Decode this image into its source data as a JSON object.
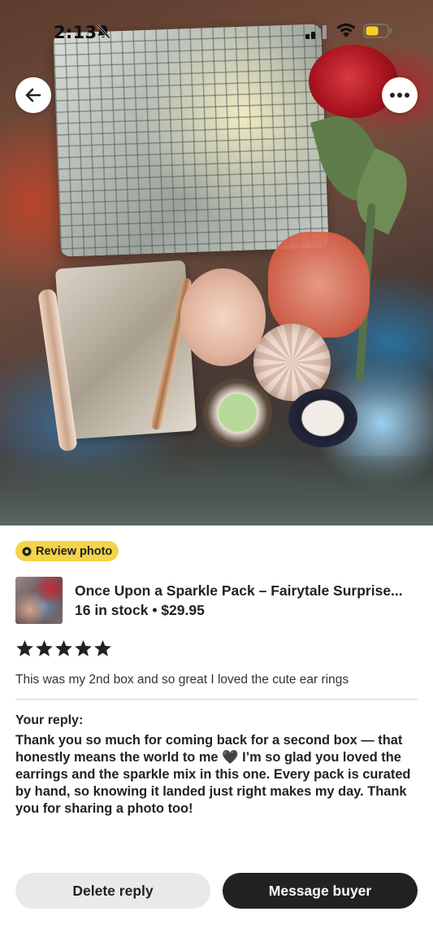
{
  "status_bar": {
    "time": "2:13"
  },
  "photo": {
    "back_icon": "arrow-left-icon",
    "more_icon": "more-horizontal-icon"
  },
  "badge": {
    "label": "Review photo",
    "icon": "camera-icon",
    "color": "#f5d34a"
  },
  "listing": {
    "title": "Once Upon a Sparkle Pack – Fairytale Surprise...",
    "meta": "16 in stock • $29.95"
  },
  "review": {
    "rating": 5,
    "rating_max": 5,
    "text": "This was my 2nd box and so great I loved the cute ear rings"
  },
  "reply": {
    "label": "Your reply:",
    "text": "Thank you so much for coming back for a second box — that honestly means the world to me 🖤 I’m so glad you loved the earrings and the sparkle mix in this one. Every pack is curated by hand, so knowing it landed just right makes my day. Thank you for sharing a photo too!"
  },
  "actions": {
    "delete_label": "Delete reply",
    "message_label": "Message buyer"
  },
  "colors": {
    "primary_button": "#222222",
    "secondary_button": "#e9e9e9",
    "star": "#222222"
  }
}
